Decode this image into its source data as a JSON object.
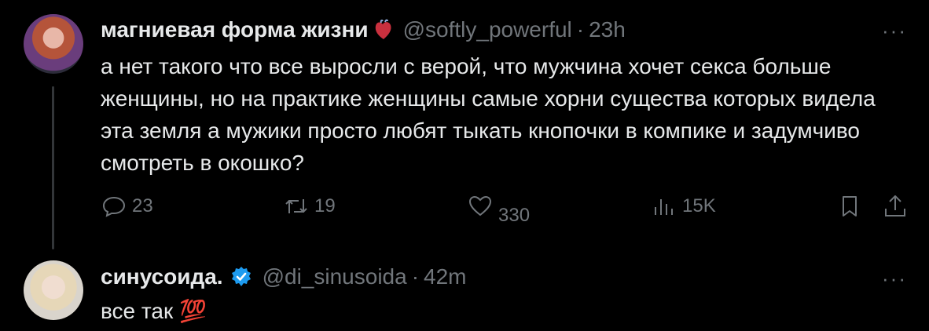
{
  "tweets": [
    {
      "display_name": "магниевая форма жизни",
      "name_emoji": "anatomical-heart-emoji",
      "handle": "@softly_powerful",
      "separator": "·",
      "time": "23h",
      "more": "···",
      "text": "а нет такого что все выросли с верой, что мужчина хочет секса больше женщины, но на практике женщины самые хорни существа которых видела эта земля а мужики просто любят тыкать кнопочки в компике и задумчиво смотреть в окошко?",
      "actions": {
        "replies": "23",
        "reposts": "19",
        "likes": "330",
        "views": "15K"
      }
    },
    {
      "display_name": "синусоида.",
      "verified": true,
      "handle": "@di_sinusoida",
      "separator": "·",
      "time": "42m",
      "more": "···",
      "text": "все так 💯"
    }
  ],
  "colors": {
    "background": "#000000",
    "text": "#e7e9ea",
    "muted": "#71767b",
    "verified": "#1d9bf0",
    "thread_line": "#333639"
  }
}
